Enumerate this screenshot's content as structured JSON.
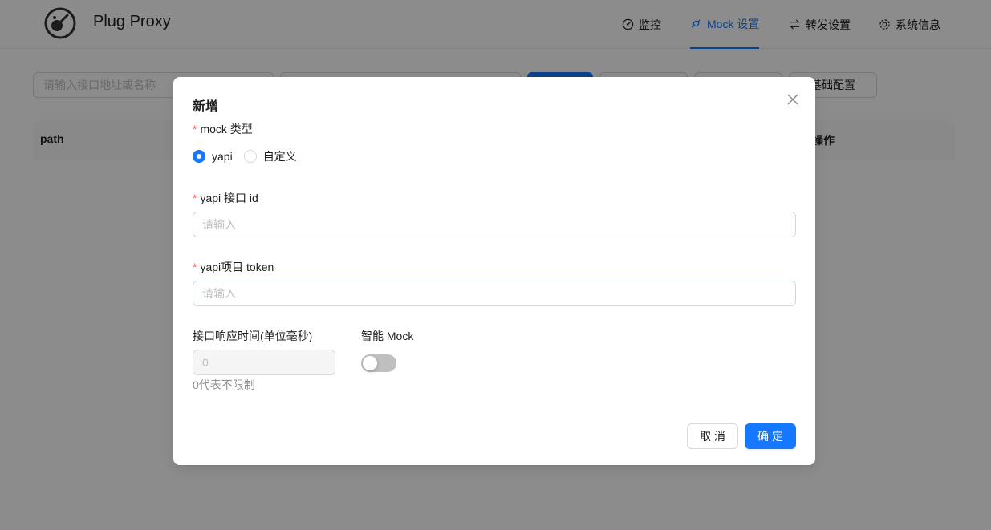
{
  "app": {
    "title": "Plug Proxy"
  },
  "nav": [
    {
      "label": "监控",
      "icon": "dashboard-icon"
    },
    {
      "label": "Mock 设置",
      "icon": "api-icon",
      "active": true
    },
    {
      "label": "转发设置",
      "icon": "swap-icon"
    },
    {
      "label": "系统信息",
      "icon": "setting-icon"
    }
  ],
  "toolbar": {
    "search_placeholder": "请输入接口地址或名称",
    "config_label": "基础配置"
  },
  "table": {
    "columns": [
      "path",
      "操作"
    ]
  },
  "modal": {
    "title": "新增",
    "mock_type_label": "mock 类型",
    "mock_type_options": [
      "yapi",
      "自定义"
    ],
    "mock_type_selected": "yapi",
    "yapi_id_label": "yapi 接口 id",
    "yapi_id_placeholder": "请输入",
    "yapi_token_label": "yapi项目 token",
    "yapi_token_placeholder": "请输入",
    "response_time_label": "接口响应时间(单位毫秒)",
    "response_time_value": "0",
    "response_time_hint": "0代表不限制",
    "smart_mock_label": "智能 Mock",
    "smart_mock_enabled": false,
    "cancel_label": "取消",
    "ok_label": "确定"
  },
  "colors": {
    "primary": "#1677ff",
    "required": "#ff4d4f"
  }
}
